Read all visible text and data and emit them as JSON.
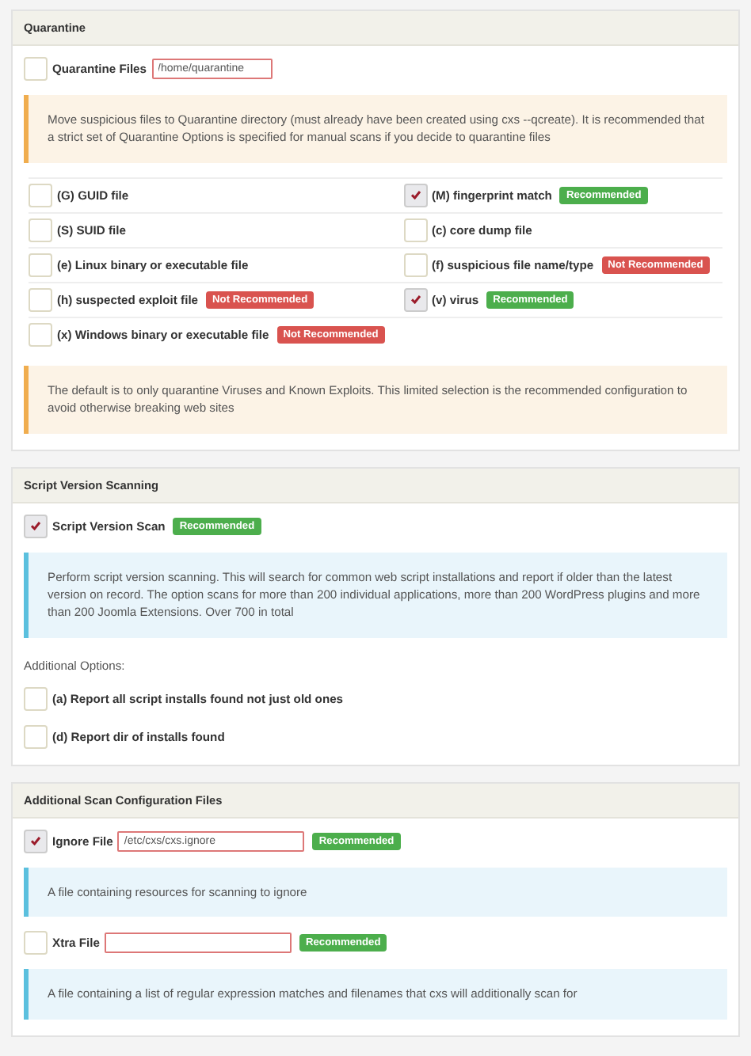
{
  "sections": [
    {
      "title": "Quarantine",
      "items": [
        {
          "kind": "field",
          "checked": false,
          "label": "Quarantine Files",
          "value": "/home/quarantine"
        },
        {
          "kind": "warning-note",
          "text": "Move suspicious files to Quarantine directory (must already have been created using cxs --qcreate). It is recommended that a strict set of Quarantine Options is specified for manual scans if you decide to quarantine files"
        },
        {
          "kind": "options",
          "options": [
            {
              "label": "(G) GUID file",
              "checked": false
            },
            {
              "label": "(M) fingerprint match",
              "checked": true,
              "badge": {
                "text": "Recommended",
                "kind": "good"
              }
            },
            {
              "label": "(S) SUID file",
              "checked": false
            },
            {
              "label": "(c) core dump file",
              "checked": false
            },
            {
              "label": "(e) Linux binary or executable file",
              "checked": false
            },
            {
              "label": "(f) suspicious file name/type",
              "checked": false,
              "badge": {
                "text": "Not Recommended",
                "kind": "bad"
              }
            },
            {
              "label": "(h) suspected exploit file",
              "checked": false,
              "badge": {
                "text": "Not Recommended",
                "kind": "bad"
              }
            },
            {
              "label": "(v) virus",
              "checked": true,
              "badge": {
                "text": "Recommended",
                "kind": "good"
              }
            },
            {
              "label": "(x) Windows binary or executable file",
              "checked": false,
              "badge": {
                "text": "Not Recommended",
                "kind": "bad"
              }
            }
          ]
        },
        {
          "kind": "warning-note",
          "text": "The default is to only quarantine Viruses and Known Exploits. This limited selection is the recommended configuration to avoid otherwise breaking web sites"
        }
      ]
    },
    {
      "title": "Script Version Scanning",
      "items": [
        {
          "kind": "field",
          "checked": true,
          "label": "Script Version Scan",
          "badge": {
            "text": "Recommended",
            "kind": "good"
          }
        },
        {
          "kind": "info-note",
          "text": "Perform script version scanning. This will search for common web script installations and report if older than the latest version on record. The option scans for more than 200 individual applications, more than 200 WordPress plugins and more than 200 Joomla Extensions. Over 700 in total"
        },
        {
          "kind": "caption",
          "text": "Additional Options:"
        },
        {
          "kind": "field",
          "checked": false,
          "label": "(a) Report all script installs found not just old ones"
        },
        {
          "kind": "field",
          "checked": false,
          "label": "(d) Report dir of installs found"
        }
      ]
    },
    {
      "title": "Additional Scan Configuration Files",
      "items": [
        {
          "kind": "field",
          "checked": true,
          "label": "Ignore File",
          "value": "/etc/cxs/cxs.ignore",
          "badge": {
            "text": "Recommended",
            "kind": "good"
          }
        },
        {
          "kind": "info-note",
          "text": "A file containing resources for scanning to ignore"
        },
        {
          "kind": "field",
          "checked": false,
          "label": "Xtra File",
          "value": "",
          "badge": {
            "text": "Recommended",
            "kind": "good"
          }
        },
        {
          "kind": "info-note",
          "text": "A file containing a list of regular expression matches and filenames that cxs will additionally scan for"
        }
      ]
    }
  ]
}
